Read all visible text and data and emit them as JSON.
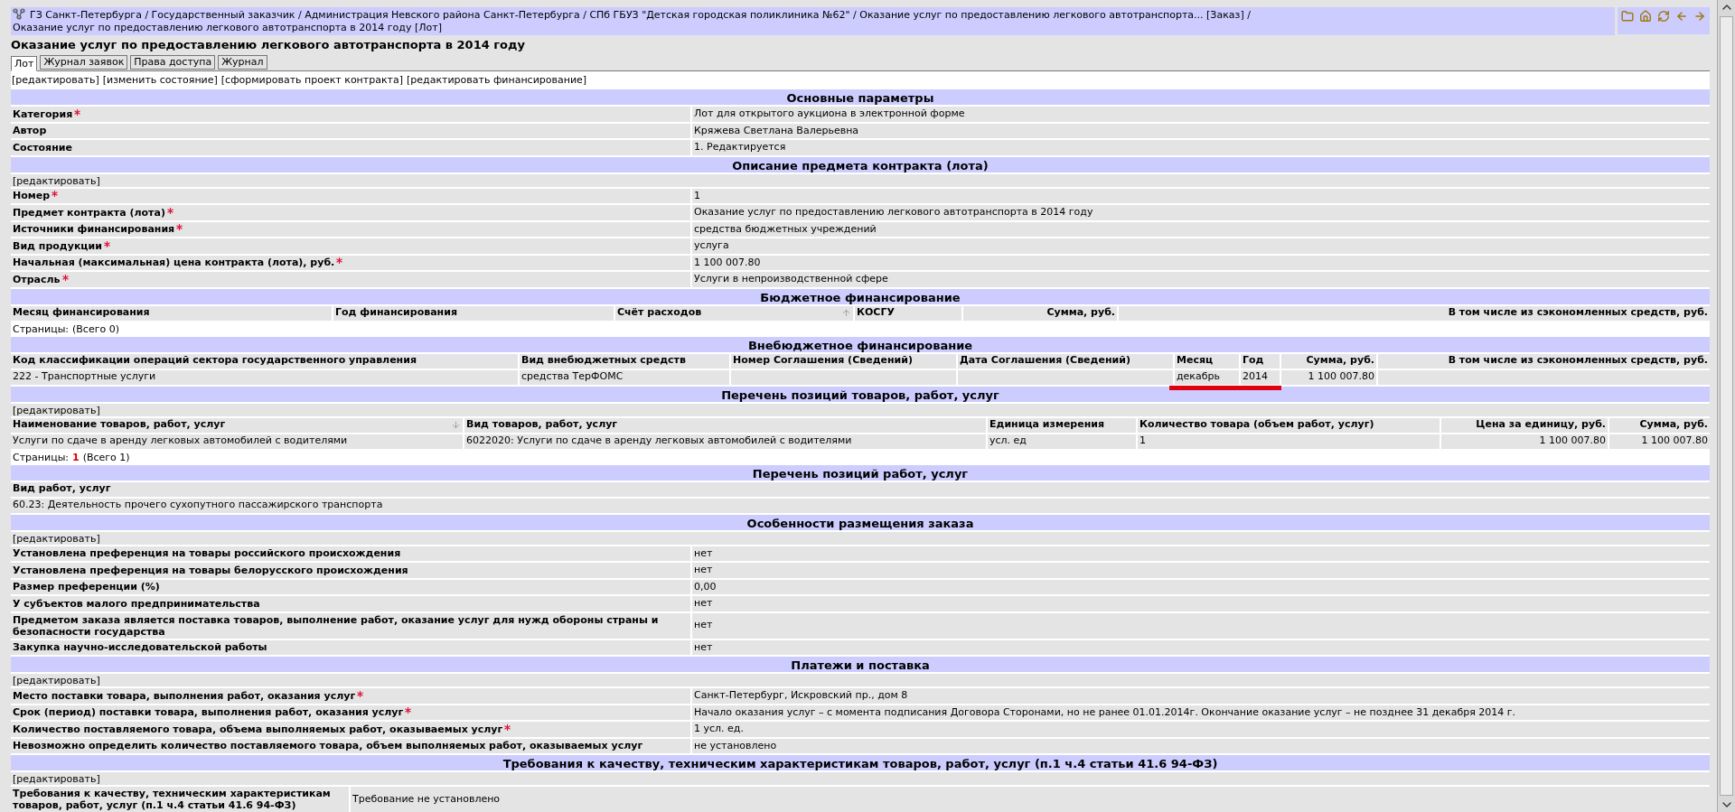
{
  "breadcrumb": {
    "separator": "/",
    "items": [
      {
        "text": "ГЗ Санкт-Петербурга"
      },
      {
        "text": "Государственный заказчик"
      },
      {
        "text": "Администрация Невского района Санкт-Петербурга"
      },
      {
        "text": "СПб ГБУЗ \"Детская городская поликлиника №62\""
      },
      {
        "text": "Оказание услуг по предоставлению легкового автотранспорта...",
        "tag": "[Заказ]"
      },
      {
        "text": "Оказание услуг по предоставлению легкового автотранспорта в 2014 году",
        "tag": "[Лот]"
      }
    ]
  },
  "title": "Оказание услуг по предоставлению легкового автотранспорта в 2014 году",
  "tabs": [
    {
      "label": "Лот",
      "selected": true
    },
    {
      "label": "Журнал заявок",
      "selected": false
    },
    {
      "label": "Права доступа",
      "selected": false
    },
    {
      "label": "Журнал",
      "selected": false
    }
  ],
  "actions": [
    "[редактировать]",
    "[изменить состояние]",
    "[сформировать проект контракта]",
    "[редактировать финансирование]"
  ],
  "sections": [
    {
      "kind": "fields",
      "title": "Основные параметры",
      "rows": [
        {
          "label": "Категория",
          "required": true,
          "value": "Лот для открытого аукциона в электронной форме"
        },
        {
          "label": "Автор",
          "required": false,
          "value": "Кряжева Светлана Валерьевна"
        },
        {
          "label": "Состояние",
          "required": false,
          "value": "1. Редактируется"
        }
      ]
    },
    {
      "kind": "fields",
      "title": "Описание предмета контракта (лота)",
      "action": "[редактировать]",
      "rows": [
        {
          "label": "Номер",
          "required": true,
          "value": "1"
        },
        {
          "label": "Предмет контракта (лота)",
          "required": true,
          "value": "Оказание услуг по предоставлению легкового автотранспорта в 2014 году"
        },
        {
          "label": "Источники финансирования",
          "required": true,
          "value": "средства бюджетных учреждений"
        },
        {
          "label": "Вид продукции",
          "required": true,
          "value": "услуга"
        },
        {
          "label": "Начальная (максимальная) цена контракта (лота), руб.",
          "required": true,
          "value": "1 100 007.80"
        },
        {
          "label": "Отрасль",
          "required": true,
          "value": "Услуги в непроизводственной сфере"
        }
      ]
    },
    {
      "kind": "budget-table",
      "title": "Бюджетное финансирование",
      "columns": [
        {
          "label": "Месяц финансирования",
          "sorted_up": false
        },
        {
          "label": "Год финансирования",
          "sorted_up": false
        },
        {
          "label": "Счёт расходов",
          "sorted_up": true
        },
        {
          "label": "КОСГУ",
          "sorted_up": false
        },
        {
          "label": "Сумма, руб.",
          "sorted_up": false
        },
        {
          "label": "В том числе из сэкономленных средств, руб.",
          "sorted_up": false
        }
      ],
      "pager": {
        "label": "Страницы:",
        "total": "(Всего 0)"
      }
    },
    {
      "kind": "offbudget-table",
      "title": "Внебюджетное финансирование",
      "columns": [
        {
          "label": "Код классификации операций сектора государственного управления"
        },
        {
          "label": "Вид внебюджетных средств"
        },
        {
          "label": "Номер Соглашения (Сведений)"
        },
        {
          "label": "Дата Соглашения (Сведений)"
        },
        {
          "label": "Месяц"
        },
        {
          "label": "Год"
        },
        {
          "label": "Сумма, руб."
        },
        {
          "label": "В том числе из сэкономленных средств, руб."
        }
      ],
      "rows": [
        {
          "cells": [
            {
              "text": "222 - Транспортные услуги",
              "underlined": false
            },
            {
              "text": "средства ТерФОМС",
              "underlined": false
            },
            {
              "underlined": false
            },
            {
              "underlined": false
            },
            {
              "text": "декабрь",
              "underlined": true
            },
            {
              "text": "2014",
              "underlined": true
            },
            {
              "text": "1 100 007.80",
              "underlined": false
            },
            {
              "underlined": false
            }
          ]
        }
      ]
    },
    {
      "kind": "items-table",
      "title": "Перечень позиций товаров, работ, услуг",
      "action": "[редактировать]",
      "columns": [
        {
          "label": "Наименование товаров, работ, услуг",
          "sorted_down": true
        },
        {
          "label": "Вид товаров, работ, услуг",
          "sorted_down": false
        },
        {
          "label": "Единица измерения",
          "sorted_down": false
        },
        {
          "label": "Количество товара (объем работ, услуг)",
          "sorted_down": false
        },
        {
          "label": "Цена за единицу, руб.",
          "sorted_down": false
        },
        {
          "label": "Сумма, руб.",
          "sorted_down": false
        }
      ],
      "rows": [
        {
          "cells": [
            "Услуги по сдаче в аренду легковых автомобилей с водителями",
            "6022020: Услуги по сдаче в аренду легковых автомобилей с водителями",
            "усл. ед",
            "1",
            "1 100 007.80",
            "1 100 007.80"
          ]
        }
      ],
      "pager": {
        "label": "Страницы:",
        "pages": [
          {
            "label": "1",
            "selected": true
          }
        ],
        "total": "(Всего 1)"
      }
    },
    {
      "kind": "works-table",
      "title": "Перечень позиций работ, услуг",
      "columns": [
        {
          "label": "Вид работ, услуг"
        }
      ],
      "rows": [
        {
          "cells": [
            "60.23: Деятельность прочего сухопутного пассажирского транспорта"
          ]
        }
      ]
    },
    {
      "kind": "fields",
      "title": "Особенности размещения заказа",
      "action": "[редактировать]",
      "rows": [
        {
          "label": "Установлена преференция на товары российского происхождения",
          "required": false,
          "value": "нет"
        },
        {
          "label": "Установлена преференция на товары белорусского происхождения",
          "required": false,
          "value": "нет"
        },
        {
          "label": "Размер преференции (%)",
          "required": false,
          "value": "0,00"
        },
        {
          "label": "У субъектов малого предпринимательства",
          "required": false,
          "value": "нет"
        },
        {
          "label": "Предметом заказа является поставка товаров, выполнение работ, оказание услуг для нужд обороны страны и безопасности государства",
          "required": false,
          "value": "нет"
        },
        {
          "label": "Закупка научно-исследовательской работы",
          "required": false,
          "value": "нет"
        }
      ]
    },
    {
      "kind": "fields",
      "title": "Платежи и поставка",
      "action": "[редактировать]",
      "rows": [
        {
          "label": "Место поставки товара, выполнения работ, оказания услуг",
          "required": true,
          "value": "Санкт-Петербург, Искровский пр., дом 8"
        },
        {
          "label": "Срок (период) поставки товара, выполнения работ, оказания услуг",
          "required": true,
          "value": "Начало оказания услуг – с момента подписания Договора Сторонами, но не ранее 01.01.2014г. Окончание оказание услуг – не позднее 31 декабря 2014 г."
        },
        {
          "label": "Количество поставляемого товара, объема выполняемых работ, оказываемых услуг",
          "required": true,
          "value": "1 усл. ед."
        },
        {
          "label": "Невозможно определить количество поставляемого товара, объем выполняемых работ, оказываемых услуг",
          "required": false,
          "value": "не установлено"
        }
      ]
    },
    {
      "kind": "narrow-fields",
      "title": "Требования к качеству, техническим характеристикам товаров, работ, услуг (п.1 ч.4 статьи 41.6 94-ФЗ)",
      "action": "[редактировать]",
      "rows": [
        {
          "label": "Требования к качеству, техническим характеристикам товаров, работ, услуг (п.1 ч.4 статьи 41.6 94-ФЗ)",
          "required": false,
          "value": "Требование не установлено"
        }
      ]
    }
  ]
}
